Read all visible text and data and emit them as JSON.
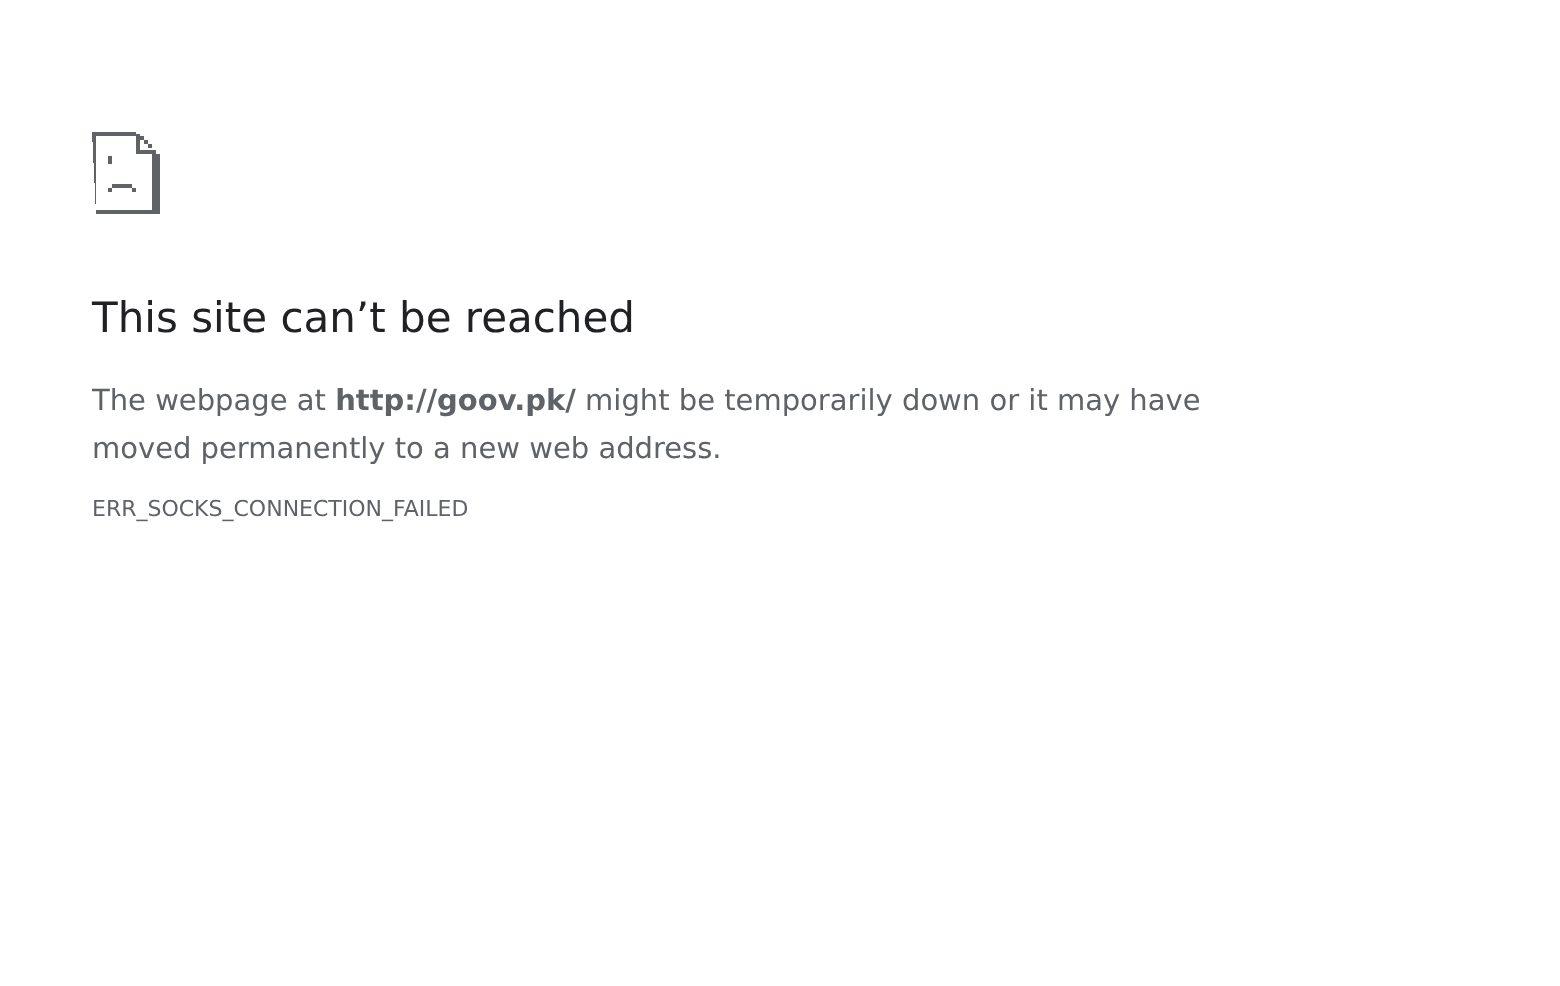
{
  "error_page": {
    "title": "This site can’t be reached",
    "message": "The webpage at **http://goov.pk/** might be temporarily down or it may have moved permanently to a new web address.",
    "error_code": "ERR_SOCKS_CONNECTION_FAILED"
  }
}
